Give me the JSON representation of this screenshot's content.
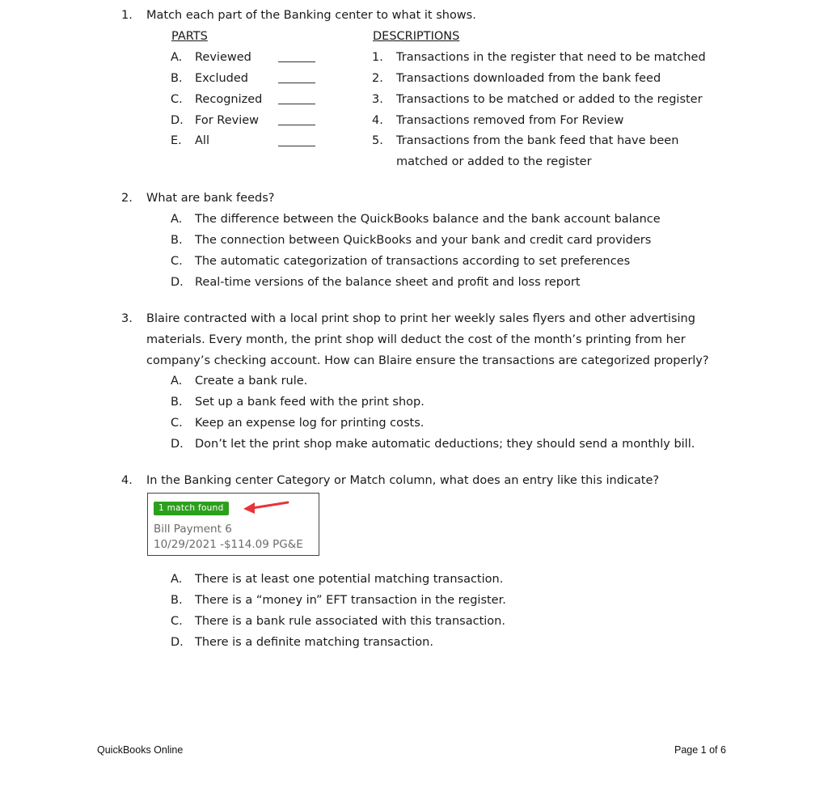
{
  "q1": {
    "number": "1.",
    "prompt": "Match each part of the Banking center to what it shows.",
    "parts_header": "PARTS",
    "descriptions_header": "DESCRIPTIONS",
    "parts": [
      {
        "letter": "A.",
        "label": "Reviewed",
        "blank": ""
      },
      {
        "letter": "B.",
        "label": "Excluded",
        "blank": ""
      },
      {
        "letter": "C.",
        "label": "Recognized",
        "blank": ""
      },
      {
        "letter": "D.",
        "label": "For Review",
        "blank": ""
      },
      {
        "letter": "E.",
        "label": "All",
        "blank": ""
      }
    ],
    "descriptions": [
      {
        "number": "1.",
        "text": "Transactions in the register that need to be matched"
      },
      {
        "number": "2.",
        "text": "Transactions downloaded from the bank feed"
      },
      {
        "number": "3.",
        "text": "Transactions to be matched or added to the register"
      },
      {
        "number": "4.",
        "text": "Transactions removed from For Review"
      },
      {
        "number": "5.",
        "text": "Transactions from the bank feed that have been",
        "continuation": "matched or added to the register"
      }
    ]
  },
  "q2": {
    "number": "2.",
    "prompt": "What are bank feeds?",
    "options": [
      {
        "letter": "A.",
        "text": "The difference between the QuickBooks balance and the bank account balance"
      },
      {
        "letter": "B.",
        "text": "The connection between QuickBooks and your bank and credit card providers"
      },
      {
        "letter": "C.",
        "text": "The automatic categorization of transactions according to set preferences"
      },
      {
        "letter": "D.",
        "text": "Real-time versions of the balance sheet and profit and loss report"
      }
    ]
  },
  "q3": {
    "number": "3.",
    "prompt_lines": [
      "Blaire contracted with a local print shop to print her weekly sales flyers and other advertising",
      "materials. Every month, the print shop will deduct the cost of the month’s printing from her",
      "company’s checking account. How can Blaire ensure the transactions are categorized properly?"
    ],
    "options": [
      {
        "letter": "A.",
        "text": "Create a bank rule."
      },
      {
        "letter": "B.",
        "text": "Set up a bank feed with the print shop."
      },
      {
        "letter": "C.",
        "text": "Keep an expense log for printing costs."
      },
      {
        "letter": "D.",
        "text": "Don’t let the print shop make automatic deductions; they should send a monthly bill."
      }
    ]
  },
  "q4": {
    "number": "4.",
    "prompt": "In the Banking center Category or Match column, what does an entry like this indicate?",
    "card": {
      "badge": "1 match found",
      "badge_color": "#2ca01c",
      "arrow_color": "#e8333a",
      "line1": "Bill Payment 6",
      "line2": "10/29/2021 -$114.09 PG&E"
    },
    "options": [
      {
        "letter": "A.",
        "text": "There is at least one potential matching transaction."
      },
      {
        "letter": "B.",
        "text": "There is a “money in” EFT transaction in the register."
      },
      {
        "letter": "C.",
        "text": "There is a bank rule associated with this transaction."
      },
      {
        "letter": "D.",
        "text": "There is a definite matching transaction."
      }
    ]
  },
  "footer": {
    "left": "QuickBooks Online",
    "right": "Page 1 of 6"
  }
}
